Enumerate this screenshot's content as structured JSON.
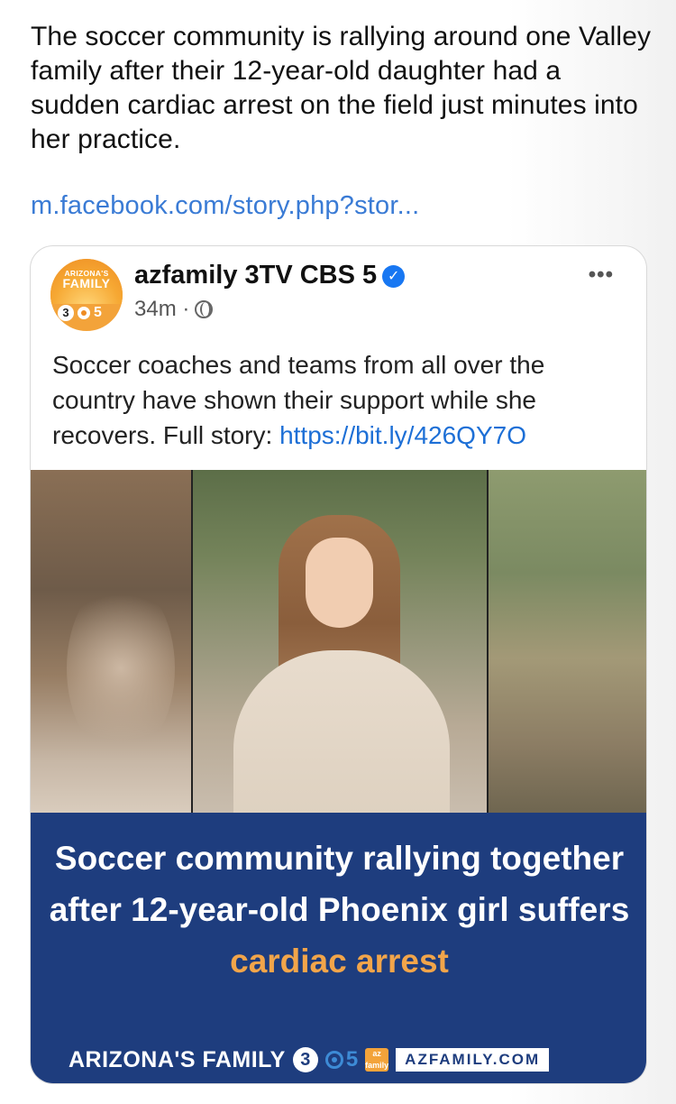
{
  "tweet": {
    "text": "The soccer community is rallying around one Valley family after their 12-year-old daughter had a sudden cardiac arrest on the field just minutes into her practice.",
    "link": "m.facebook.com/story.php?stor..."
  },
  "card": {
    "avatar": {
      "line1": "ARIZONA'S",
      "line2": "FAMILY",
      "num3": "3",
      "num5": "5"
    },
    "page_name": "azfamily 3TV CBS 5",
    "time": "34m ·",
    "more": "•••",
    "post_text": "Soccer coaches and teams from all over the country have shown their support while she recovers. Full story: ",
    "post_link": "https://bit.ly/426QY7O",
    "banner": {
      "headline": "Soccer community rallying together after 12-year-old Phoenix girl suffers",
      "headline_accent": "cardiac arrest",
      "brand": "ARIZONA'S FAMILY",
      "brand_3": "3",
      "brand_5": "5",
      "brand_az": "az family",
      "url": "AZFAMILY.COM"
    }
  },
  "colors": {
    "link": "#3a7bd5",
    "banner": "#1e3d7e",
    "accent": "#f2a54a",
    "verified": "#1877f2"
  },
  "icons": [
    "verified-icon",
    "globe-icon",
    "more-icon"
  ]
}
